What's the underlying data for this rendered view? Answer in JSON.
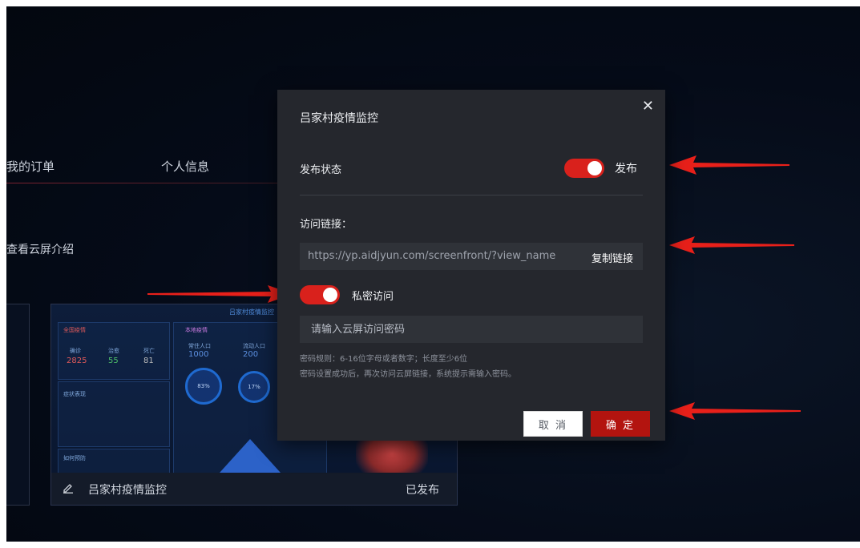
{
  "background": {
    "tabs": [
      "我的订单",
      "个人信息"
    ],
    "intro_link": "查看云屏介绍",
    "card": {
      "name": "吕家村疫情监控",
      "status": "已发布",
      "thumbnail": {
        "title": "吕家村疫情监控",
        "panel1_title": "全国疫情",
        "panel1_labels": [
          "确诊",
          "治愈",
          "死亡"
        ],
        "panel1_values": [
          "2825",
          "55",
          "81"
        ],
        "panel2_title": "症状表现",
        "panel3_title": "如何预防",
        "panel4_title": "本地疫情",
        "panel4_labels": [
          "常住人口",
          "流动人口"
        ],
        "panel4_values": [
          "1000",
          "200"
        ],
        "circle_values": [
          "83%",
          "17%"
        ]
      }
    }
  },
  "modal": {
    "title": "吕家村疫情监控",
    "publish_label": "发布状态",
    "publish_toggle_on": true,
    "publish_state_text": "发布",
    "link_label": "访问链接：",
    "url": "https://yp.aidjyun.com/screenfront/?view_name",
    "copy_link": "复制链接",
    "private_toggle_on": true,
    "private_label": "私密访问",
    "password_placeholder": "请输入云屏访问密码",
    "hint_rule": "密码规则：6-16位字母或者数字；长度至少6位",
    "hint_info": "密码设置成功后，再次访问云屏链接，系统提示需输入密码。",
    "cancel_label": "取 消",
    "confirm_label": "确 定"
  },
  "colors": {
    "accent_red": "#d9211c",
    "confirm_red": "#b3140f",
    "modal_bg": "#25272d",
    "page_bg": "#050b18"
  }
}
